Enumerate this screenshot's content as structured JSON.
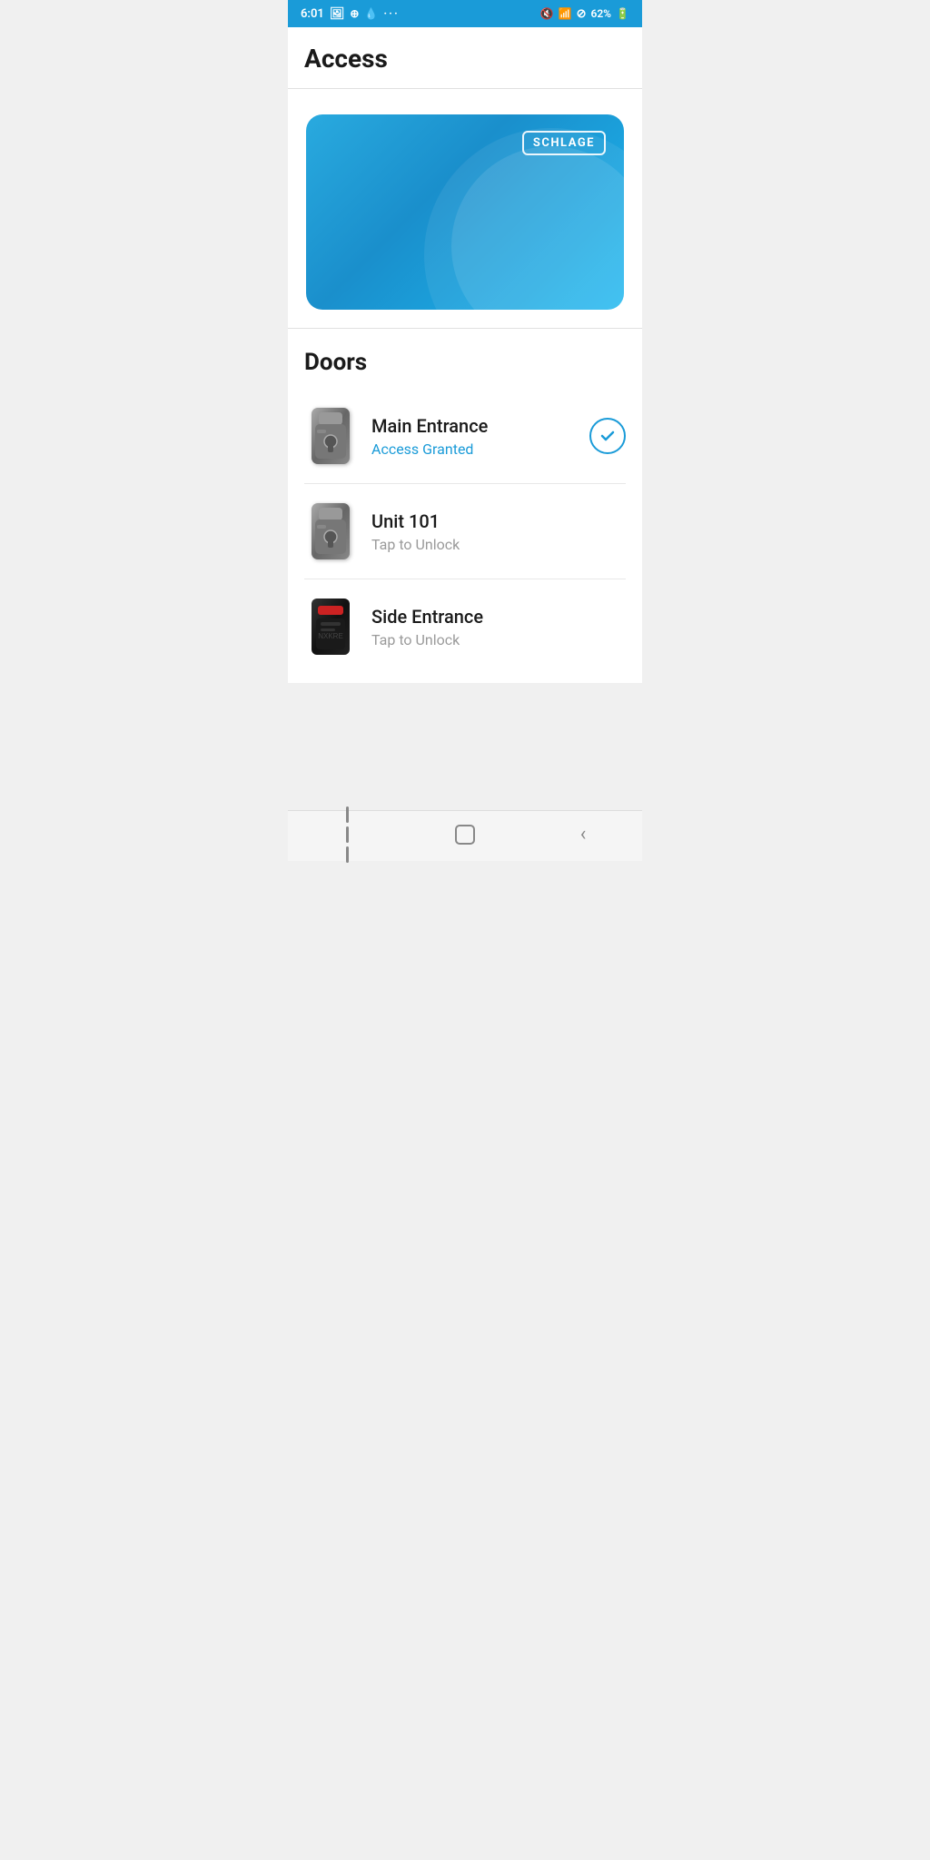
{
  "statusBar": {
    "time": "6:01",
    "battery": "62%",
    "icons": [
      "image",
      "link",
      "location",
      "dots"
    ]
  },
  "header": {
    "title": "Access"
  },
  "card": {
    "brand": "SCHLAGE"
  },
  "doors": {
    "sectionTitle": "Doors",
    "items": [
      {
        "id": "main-entrance",
        "name": "Main Entrance",
        "status": "Access Granted",
        "statusType": "granted",
        "iconType": "silver"
      },
      {
        "id": "unit-101",
        "name": "Unit 101",
        "status": "Tap to Unlock",
        "statusType": "tap",
        "iconType": "silver"
      },
      {
        "id": "side-entrance",
        "name": "Side Entrance",
        "status": "Tap to Unlock",
        "statusType": "tap",
        "iconType": "black"
      }
    ]
  },
  "bottomNav": {
    "items": [
      "menu",
      "home",
      "back"
    ]
  }
}
